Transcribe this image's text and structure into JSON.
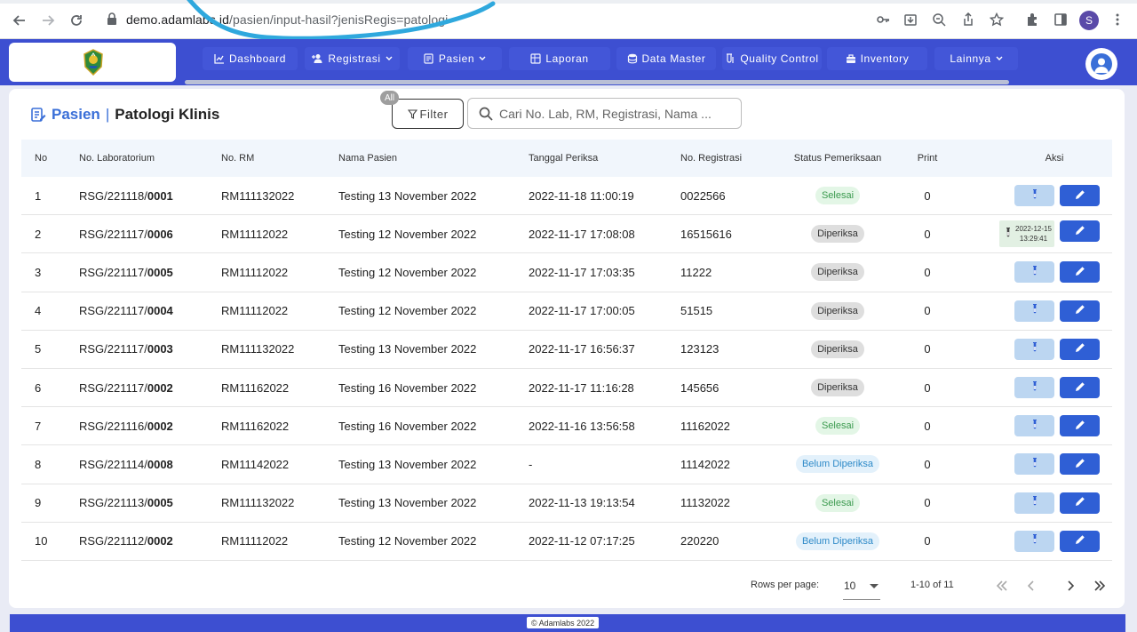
{
  "browser": {
    "url_host": "demo.adamlabs.id",
    "url_path": "/pasien/input-hasil?jenisRegis=patologi",
    "profile_initial": "S"
  },
  "nav": {
    "items": [
      {
        "label": "Dashboard",
        "icon": "chart-line-icon",
        "glyph": "📈"
      },
      {
        "label": "Registrasi",
        "icon": "user-plus-icon",
        "glyph": "👤"
      },
      {
        "label": "Pasien",
        "icon": "list-icon",
        "glyph": "▤"
      },
      {
        "label": "Laporan",
        "icon": "report-icon",
        "glyph": "▦"
      },
      {
        "label": "Data Master",
        "icon": "database-icon",
        "glyph": "⛁"
      },
      {
        "label": "Quality Control",
        "icon": "qc-icon",
        "glyph": "⚗"
      },
      {
        "label": "Inventory",
        "icon": "inventory-icon",
        "glyph": "▣"
      },
      {
        "label": "Lainnya",
        "icon": "",
        "glyph": ""
      }
    ]
  },
  "page": {
    "crumb": "Pasien",
    "separator": "|",
    "title": "Patologi Klinis",
    "filter_badge": "All",
    "filter_label": "Filter",
    "search_placeholder": "Cari No. Lab, RM, Registrasi, Nama ..."
  },
  "table": {
    "headers": {
      "no": "No",
      "lab": "No. Laboratorium",
      "rm": "No. RM",
      "nama": "Nama Pasien",
      "tgl": "Tanggal Periksa",
      "reg": "No. Registrasi",
      "status": "Status Pemeriksaan",
      "print": "Print",
      "aksi": "Aksi"
    },
    "rows": [
      {
        "no": "1",
        "lab_prefix": "RSG/221118/",
        "lab_num": "0001",
        "rm": "RM111132022",
        "nama": "Testing 13 November 2022",
        "tgl": "2022-11-18 11:00:19",
        "reg": "0022566",
        "status": "Selesai",
        "print": "0"
      },
      {
        "no": "2",
        "lab_prefix": "RSG/221117/",
        "lab_num": "0006",
        "rm": "RM11112022",
        "nama": "Testing 12 November 2022",
        "tgl": "2022-11-17 17:08:08",
        "reg": "16515616",
        "status": "Diperiksa",
        "print": "0",
        "stamp_date": "2022-12-15",
        "stamp_time": "13:29:41"
      },
      {
        "no": "3",
        "lab_prefix": "RSG/221117/",
        "lab_num": "0005",
        "rm": "RM11112022",
        "nama": "Testing 12 November 2022",
        "tgl": "2022-11-17 17:03:35",
        "reg": "11222",
        "status": "Diperiksa",
        "print": "0"
      },
      {
        "no": "4",
        "lab_prefix": "RSG/221117/",
        "lab_num": "0004",
        "rm": "RM11112022",
        "nama": "Testing 12 November 2022",
        "tgl": "2022-11-17 17:00:05",
        "reg": "51515",
        "status": "Diperiksa",
        "print": "0"
      },
      {
        "no": "5",
        "lab_prefix": "RSG/221117/",
        "lab_num": "0003",
        "rm": "RM111132022",
        "nama": "Testing 13 November 2022",
        "tgl": "2022-11-17 16:56:37",
        "reg": "123123",
        "status": "Diperiksa",
        "print": "0"
      },
      {
        "no": "6",
        "lab_prefix": "RSG/221117/",
        "lab_num": "0002",
        "rm": "RM11162022",
        "nama": "Testing 16 November 2022",
        "tgl": "2022-11-17 11:16:28",
        "reg": "145656",
        "status": "Diperiksa",
        "print": "0"
      },
      {
        "no": "7",
        "lab_prefix": "RSG/221116/",
        "lab_num": "0002",
        "rm": "RM11162022",
        "nama": "Testing 16 November 2022",
        "tgl": "2022-11-16 13:56:58",
        "reg": "11162022",
        "status": "Selesai",
        "print": "0"
      },
      {
        "no": "8",
        "lab_prefix": "RSG/221114/",
        "lab_num": "0008",
        "rm": "RM11142022",
        "nama": "Testing 13 November 2022",
        "tgl": "-",
        "reg": "11142022",
        "status": "Belum Diperiksa",
        "print": "0"
      },
      {
        "no": "9",
        "lab_prefix": "RSG/221113/",
        "lab_num": "0005",
        "rm": "RM111132022",
        "nama": "Testing 13 November 2022",
        "tgl": "2022-11-13 19:13:54",
        "reg": "11132022",
        "status": "Selesai",
        "print": "0"
      },
      {
        "no": "10",
        "lab_prefix": "RSG/221112/",
        "lab_num": "0002",
        "rm": "RM11112022",
        "nama": "Testing 12 November 2022",
        "tgl": "2022-11-12 07:17:25",
        "reg": "220220",
        "status": "Belum Diperiksa",
        "print": "0"
      }
    ]
  },
  "pagination": {
    "rows_per_page_label": "Rows per page:",
    "rows_per_page_value": "10",
    "range": "1-10 of 11"
  },
  "footer": {
    "copyright": "© Adamlabs 2022"
  },
  "colors": {
    "brand": "#3d4fd1",
    "accent": "#3a6fd8",
    "edit_button": "#2f5fd5",
    "tube_button": "#bcd6f1"
  }
}
